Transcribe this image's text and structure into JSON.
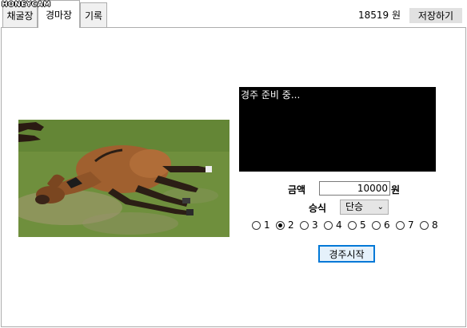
{
  "watermark": "HONEYCAM",
  "tabs": [
    {
      "label": "채굴장"
    },
    {
      "label": "경마장"
    },
    {
      "label": "기록"
    }
  ],
  "header": {
    "money": "18519 원",
    "save_label": "저장하기"
  },
  "race": {
    "console_text": "경주 준비 중...",
    "amount_label": "금액",
    "amount_value": "10000",
    "amount_unit": "원",
    "bet_label": "승식",
    "bet_selected": "단승",
    "horses": [
      "1",
      "2",
      "3",
      "4",
      "5",
      "6",
      "7",
      "8"
    ],
    "selected_horse": "2",
    "start_label": "경주시작"
  },
  "colors": {
    "accent": "#0078d7",
    "console_bg": "#000000",
    "grass": "#6f8f3d",
    "horse": "#a0602f"
  }
}
